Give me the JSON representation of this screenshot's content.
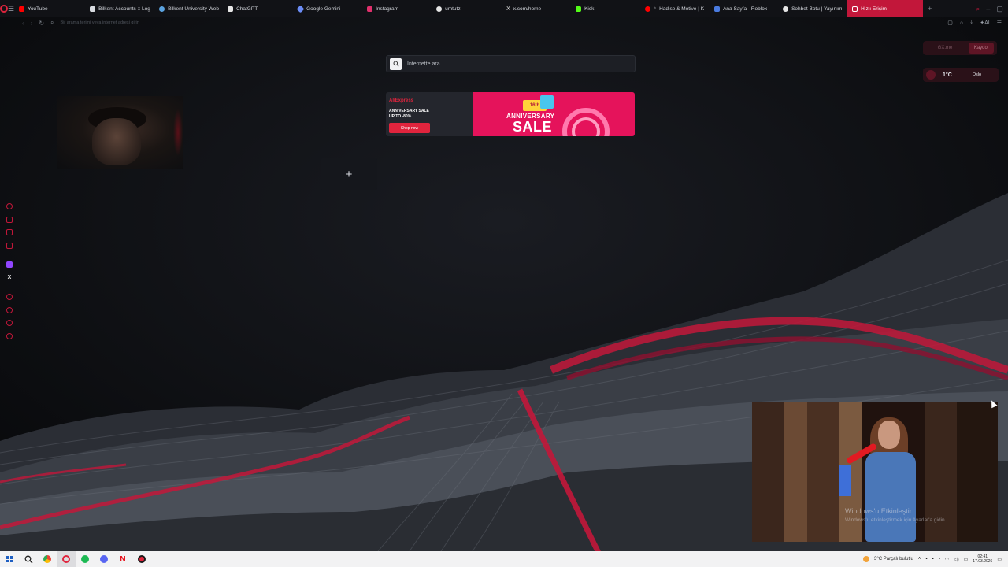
{
  "browser": {
    "tabs": [
      {
        "label": "YouTube",
        "color": "#ff0000"
      },
      {
        "label": "Bilkent Accounts :: Log",
        "color": "#d8dbe0"
      },
      {
        "label": "Bilkent University Web",
        "color": "#5ba3e0"
      },
      {
        "label": "ChatGPT",
        "color": "#e6e6e6"
      },
      {
        "label": "Google Gemini",
        "color": "#6b8cf5"
      },
      {
        "label": "Instagram",
        "color": "#e1306c"
      },
      {
        "label": "umtutz",
        "color": "#e6e6e6"
      },
      {
        "label": "x.com/home",
        "color": "#e6e6e6"
      },
      {
        "label": "Kick",
        "color": "#53fc18"
      },
      {
        "label": "Hadise & Motive | K",
        "color": "#ff0000"
      },
      {
        "label": "Ana Sayfa - Roblox",
        "color": "#4a7be0"
      },
      {
        "label": "Sohbet Botu | Yayınım",
        "color": "#e6e6e6"
      },
      {
        "label": "Hızlı Erişim",
        "color": "#ffffff"
      }
    ],
    "active_tab_index": 12,
    "address_placeholder": "Bir arama terimi veya internet adresi girin",
    "accent_color": "#c2173a"
  },
  "speed_dial": {
    "search_placeholder": "İnternette ara",
    "add_tile_symbol": "+"
  },
  "ad": {
    "brand": "AliExpress",
    "line1": "ANNIVERSARY SALE",
    "line2": "UP TO -80%",
    "cta": "Shop now",
    "badge": "16th",
    "headline_small": "ANNIVERSARY",
    "headline_big": "SALE",
    "banner_color": "#e5135b"
  },
  "widgets": {
    "gx_label": "GX.me",
    "gx_button": "Kaydol",
    "weather_temp": "1°C",
    "weather_city": "Oslo"
  },
  "video": {
    "watermark_title": "Windows'u Etkinleştir",
    "watermark_sub": "Windows'u etkinleştirmek için Ayarlar'a gidin."
  },
  "taskbar": {
    "weather": "3°C",
    "weather_desc": "Parçalı bulutlu",
    "time": "02:41",
    "date": "17.03.2026",
    "apps": [
      {
        "name": "search-icon",
        "color": "#222222"
      },
      {
        "name": "chrome-icon",
        "color": "#34a853"
      },
      {
        "name": "opera-icon",
        "color": "#e0243d"
      },
      {
        "name": "spotify-icon",
        "color": "#1db954"
      },
      {
        "name": "discord-icon",
        "color": "#5865f2"
      },
      {
        "name": "netflix-icon",
        "color": "#e50914"
      },
      {
        "name": "opera-gx-icon",
        "color": "#e0243d"
      }
    ]
  }
}
